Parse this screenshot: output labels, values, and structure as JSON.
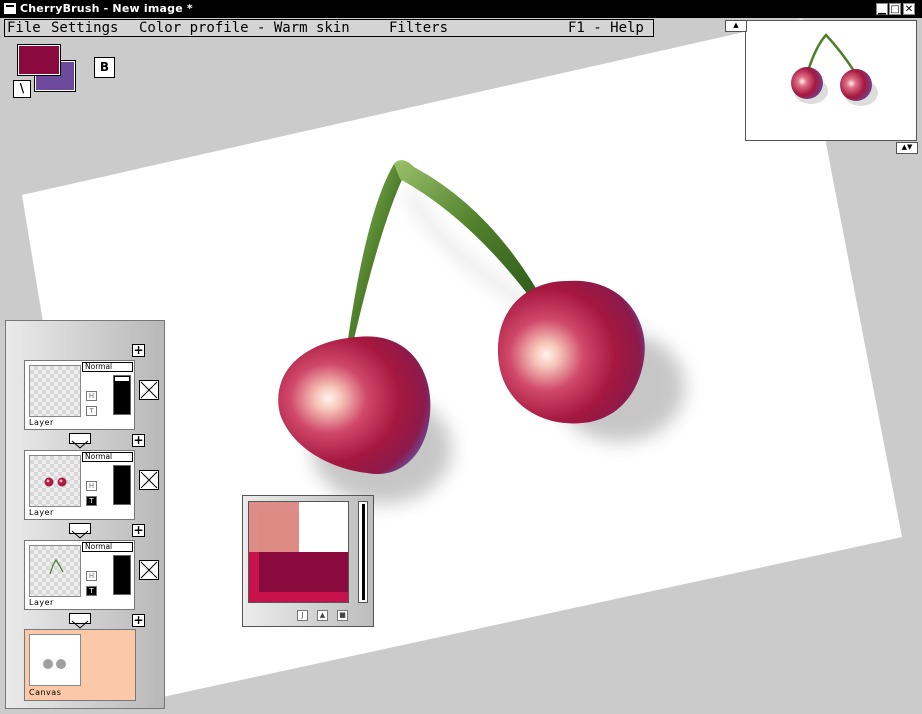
{
  "window": {
    "title": "CherryBrush - New image *",
    "controls": [
      "minimize",
      "maximize",
      "close"
    ]
  },
  "menu": {
    "items": [
      {
        "label": "File"
      },
      {
        "label": "Settings"
      },
      {
        "label": "Color profile - Warm skin"
      },
      {
        "label": "Filters"
      }
    ],
    "help": "F1 - Help"
  },
  "colors": {
    "foreground": "#8b0a3e",
    "background": "#6e4a9c",
    "swap_glyph": "\\",
    "brush_button": "B"
  },
  "layers_panel": {
    "layers": [
      {
        "name": "Layer",
        "blend": "Normal",
        "hide": "H",
        "transparency": "T",
        "content": "empty"
      },
      {
        "name": "Layer",
        "blend": "Normal",
        "hide": "H",
        "transparency": "T",
        "content": "cherries"
      },
      {
        "name": "Layer",
        "blend": "Normal",
        "hide": "H",
        "transparency": "T",
        "content": "stems"
      }
    ],
    "canvas": {
      "name": "Canvas"
    },
    "add_glyph": "+"
  },
  "mixer": {
    "buttons": [
      "J",
      "▲",
      "■"
    ]
  },
  "navigator": {
    "arrow_up": "▲",
    "arrow_updown": "▲▼"
  }
}
